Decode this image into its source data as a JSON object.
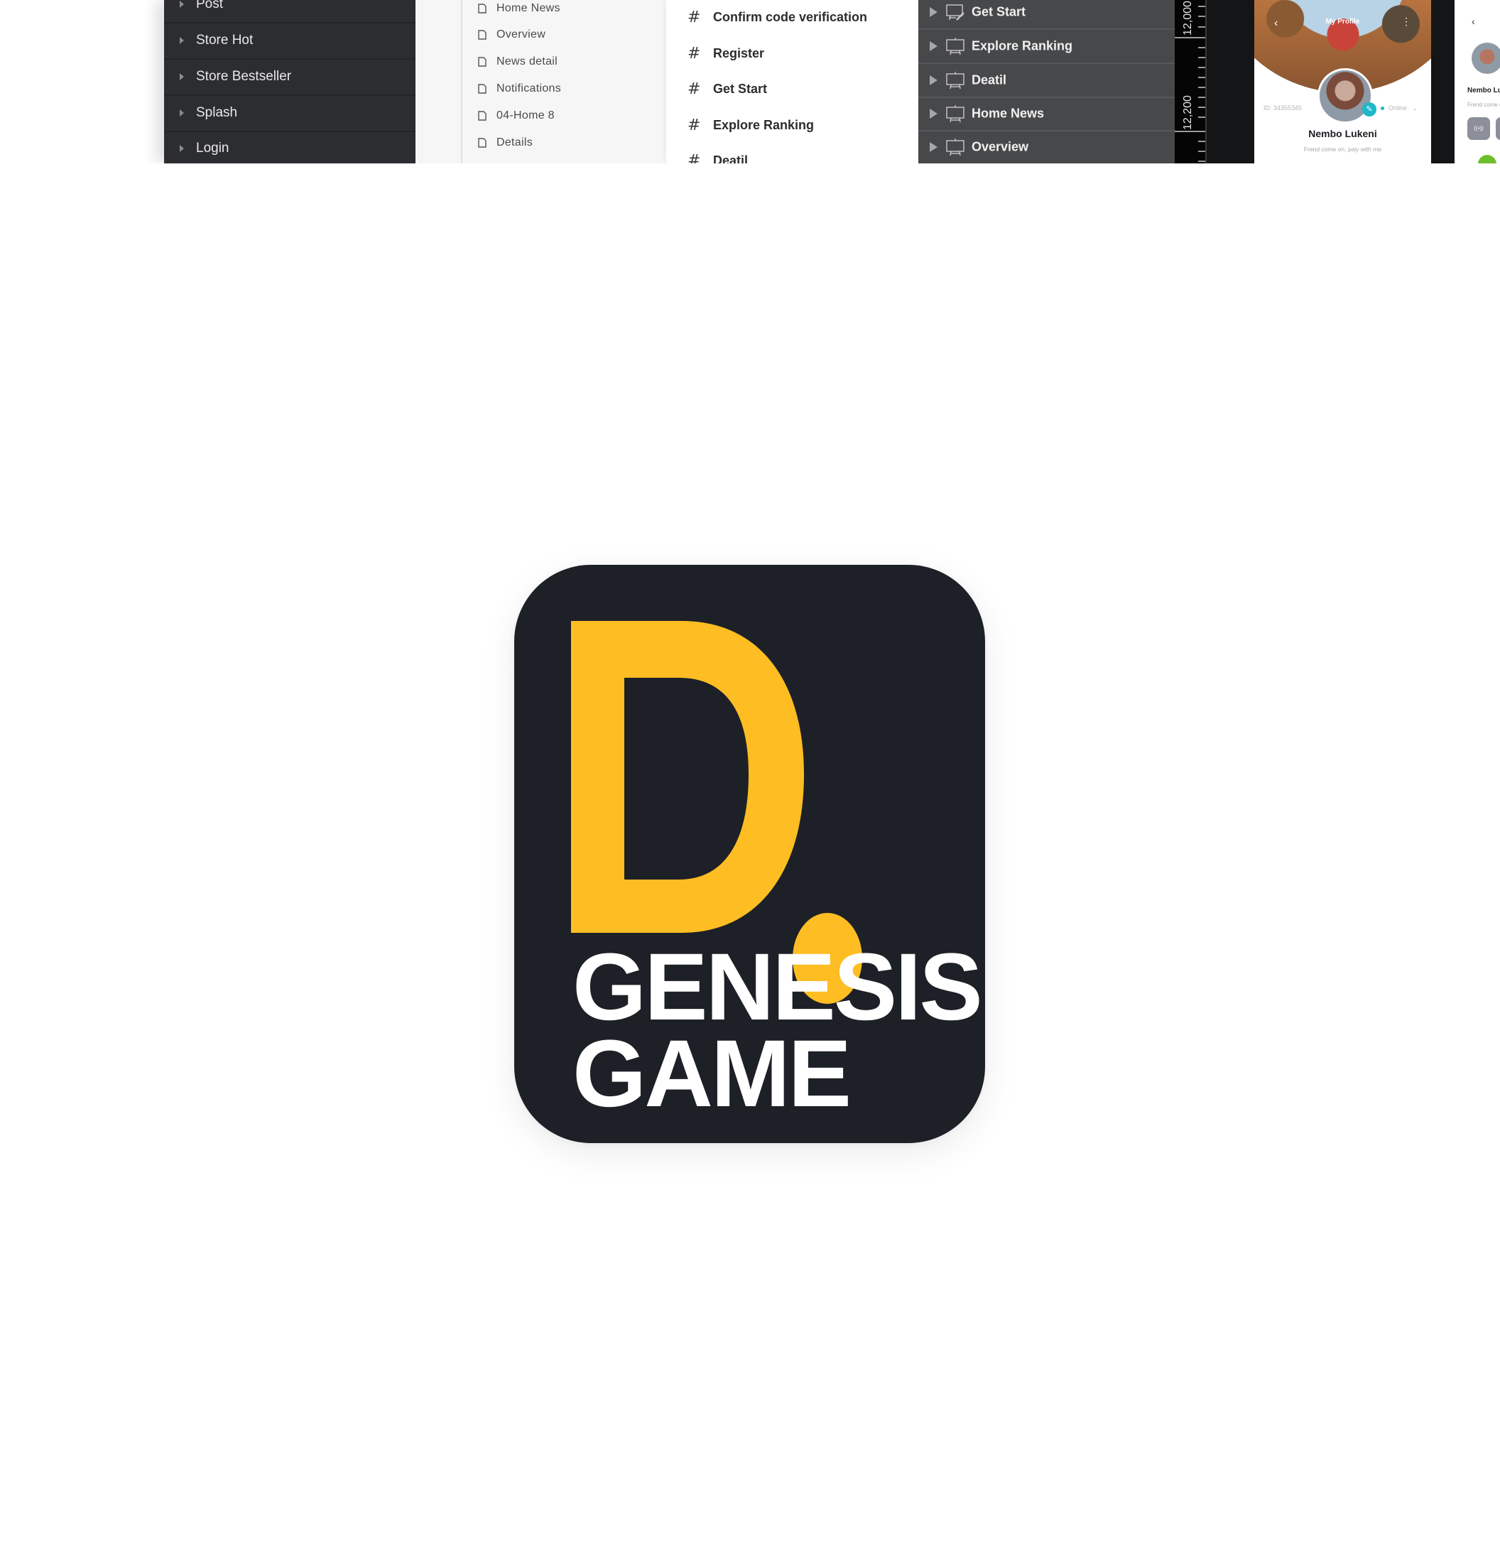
{
  "layers_panel": {
    "items": [
      {
        "label": "Post",
        "icon": "home-icon"
      },
      {
        "label": "Store Hot"
      },
      {
        "label": "Store Bestseller"
      },
      {
        "label": "Splash"
      },
      {
        "label": "Login"
      }
    ]
  },
  "pages_panel": {
    "items": [
      "Home News",
      "Overview",
      "News detail",
      "Notifications",
      "04-Home 8",
      "Details"
    ],
    "item_icon": "document-icon"
  },
  "frames_panel": {
    "items": [
      "Confirm code verification",
      "Register",
      "Get Start",
      "Explore Ranking",
      "Deatil"
    ],
    "item_icon": "hash-icon"
  },
  "artboards_panel": {
    "items": [
      "Get Start",
      "Explore Ranking",
      "Deatil",
      "Home News",
      "Overview"
    ],
    "item_icon": "artboard-icon"
  },
  "ruler": {
    "labels": [
      "12,000",
      "12,200"
    ]
  },
  "profile_mockup": {
    "title": "My Profile",
    "back": "‹",
    "more": "⋮",
    "id_text": "ID: 34355345",
    "status": "Online",
    "name": "Nembo Lukeni",
    "bio": "Frend come on, paly with me",
    "edit_glyph": "✎",
    "status_color": "#1eb6c9"
  },
  "profile_mockup_2": {
    "back": "‹",
    "name": "Nembo Lukeni",
    "bio": "Frend come on, paly with me",
    "broadcast_glyph": "((•))"
  },
  "logo": {
    "letter": "D",
    "line1": "GENESIS",
    "line2": "GAME",
    "accent_color": "#fdbd23",
    "background_color": "#1d2026",
    "text_color": "#ffffff"
  }
}
